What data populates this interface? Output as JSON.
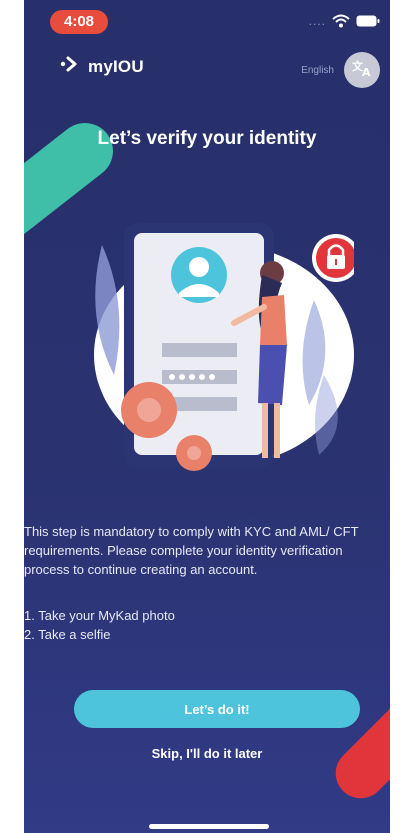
{
  "status_bar": {
    "time": "4:08"
  },
  "header": {
    "brand": "myIOU",
    "language_label": "English"
  },
  "title": "Let’s verify your identity",
  "description": "This step is mandatory to comply with KYC and AML/ CFT requirements. Please complete your identity verification process to continue creating an account.",
  "steps": [
    "1. Take your MyKad photo",
    "2. Take a selfie"
  ],
  "primary_button": "Let’s do it!",
  "skip_link": "Skip, I'll do it later",
  "colors": {
    "background": "#2a3270",
    "accent_teal": "#4ec3dc",
    "accent_green": "#3fbfa7",
    "accent_red": "#e0353b"
  },
  "icons": [
    "wifi-icon",
    "battery-icon",
    "arrow-logo-icon",
    "translate-icon",
    "lock-icon",
    "user-avatar-icon",
    "gear-icon"
  ]
}
